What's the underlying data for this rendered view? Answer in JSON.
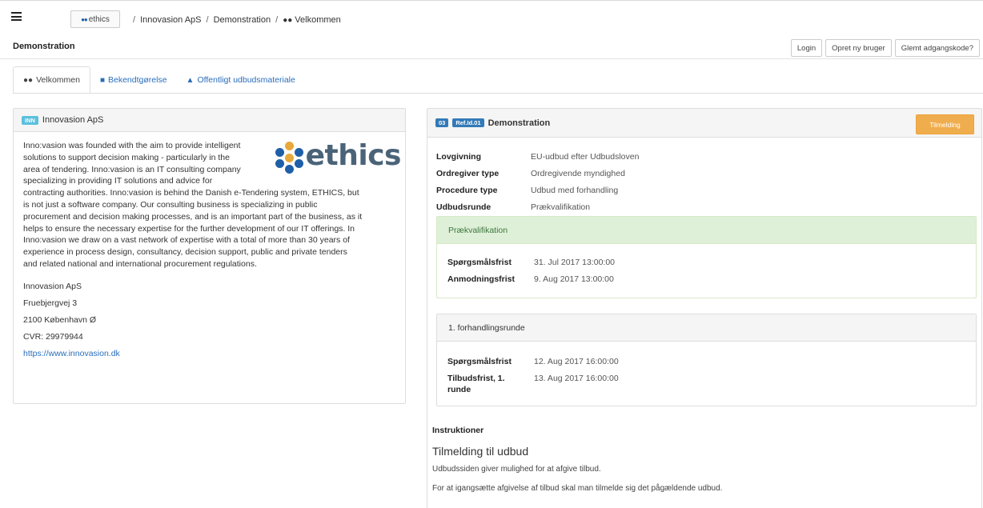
{
  "topbar": {
    "logo_text": "ethics",
    "breadcrumb": [
      "Innovasion ApS",
      "Demonstration",
      "Velkommen"
    ]
  },
  "page_title": "Demonstration",
  "auth": {
    "login": "Login",
    "register": "Opret ny bruger",
    "forgot": "Glemt adgangskode?"
  },
  "tabs": [
    {
      "label": "Velkommen",
      "icon": "users-icon"
    },
    {
      "label": "Bekendtgørelse",
      "icon": "newspaper-icon"
    },
    {
      "label": "Offentligt udbudsmateriale",
      "icon": "folder-open-icon"
    }
  ],
  "company": {
    "badge": "INN",
    "name": "Innovasion ApS",
    "logo_text": "ethics",
    "about_lines": [
      "Inno:vasion was founded with the aim to provide intelligent",
      "solutions to support decision making - particularly in the",
      "area of tendering. Inno:vasion is an IT consulting company",
      "specializing in providing IT solutions and advice for",
      "contracting authorities. Inno:vasion is behind the Danish e-Tendering system, ETHICS, but",
      "is not just a software company. Our consulting business is specializing in public",
      "procurement and decision making processes, and is an important part of the business, as it",
      "helps to ensure the necessary expertise for the further development of our IT offerings. In",
      "Inno:vasion we draw on a vast network of expertise with a total of more than 30 years of",
      "experience in process design, consultancy, decision support, public and private tenders",
      "and related national and international procurement regulations."
    ],
    "address": {
      "company": "Innovasion ApS",
      "street": "Fruebjergvej 3",
      "city": "2100 København Ø",
      "cvr": "CVR: 29979944",
      "url": "https://www.innovasion.dk"
    }
  },
  "tender": {
    "badge_num": "03",
    "badge_ref": "Ref.Id.01",
    "title": "Demonstration",
    "signup_button": "Tilmelding",
    "facts": [
      {
        "key": "Lovgivning",
        "value": "EU-udbud efter Udbudsloven"
      },
      {
        "key": "Ordregiver type",
        "value": "Ordregivende myndighed"
      },
      {
        "key": "Procedure type",
        "value": "Udbud med forhandling"
      },
      {
        "key": "Udbudsrunde",
        "value": "Prækvalifikation"
      }
    ],
    "prequal": {
      "title": "Prækvalifikation",
      "rows": [
        {
          "key": "Spørgsmålsfrist",
          "value": "31. Jul 2017 13:00:00"
        },
        {
          "key": "Anmodningsfrist",
          "value": "9. Aug 2017 13:00:00"
        }
      ]
    },
    "round1": {
      "title": "1. forhandlingsrunde",
      "rows": [
        {
          "key": "Spørgsmålsfrist",
          "value": "12. Aug 2017 16:00:00"
        },
        {
          "key_line1": "Tilbudsfrist, 1.",
          "key_line2": "runde",
          "value": "13. Aug 2017 16:00:00"
        }
      ]
    },
    "instructions": {
      "label": "Instruktioner",
      "title": "Tilmelding til udbud",
      "p1": "Udbudssiden giver mulighed for at afgive tilbud.",
      "p2": "For at igangsætte afgivelse af tilbud skal man tilmelde sig det pågældende udbud."
    }
  },
  "colors": {
    "link": "#2a6ebb",
    "warning": "#f0ad4e",
    "success_bg": "#dff0d8",
    "success_text": "#3c763d",
    "info": "#5bc0de",
    "primary": "#337ab7"
  }
}
